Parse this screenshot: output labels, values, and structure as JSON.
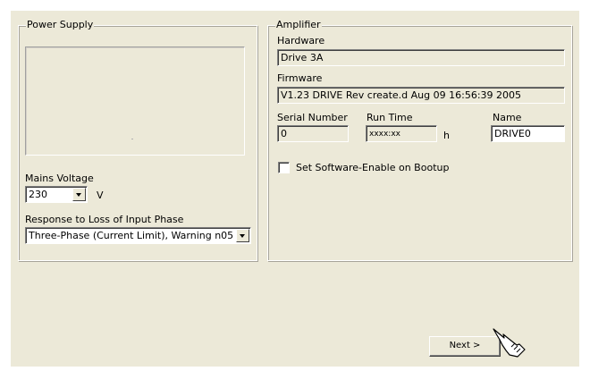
{
  "power_supply": {
    "title": "Power Supply",
    "mains_voltage": {
      "label": "Mains Voltage",
      "value": "230",
      "unit": "V"
    },
    "response_loss_phase": {
      "label": "Response to Loss of Input Phase",
      "value": "Three-Phase (Current Limit), Warning n05"
    }
  },
  "amplifier": {
    "title": "Amplifier",
    "hardware": {
      "label": "Hardware",
      "value": "Drive 3A"
    },
    "firmware": {
      "label": "Firmware",
      "value": "V1.23 DRIVE Rev create.d Aug 09 16:56:39 2005"
    },
    "serial_number": {
      "label": "Serial Number",
      "value": "0"
    },
    "run_time": {
      "label": "Run Time",
      "value": "xxxx:xx",
      "unit": "h"
    },
    "name": {
      "label": "Name",
      "value": "DRIVE0"
    },
    "software_enable": {
      "label": "Set Software-Enable on Bootup",
      "checked": false
    }
  },
  "footer": {
    "next_label": "Next >"
  },
  "icons": {
    "dropdown": "chevron-down-icon",
    "pointer": "hand-pointer-icon"
  }
}
